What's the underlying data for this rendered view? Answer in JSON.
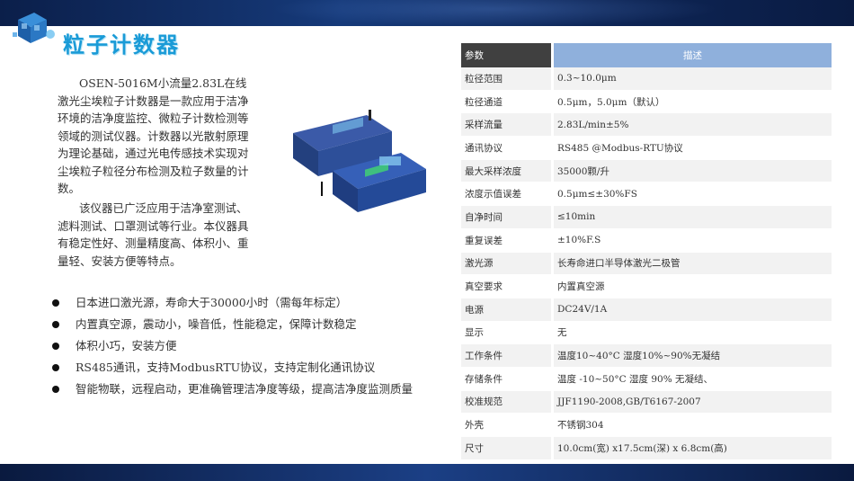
{
  "title": "粒子计数器",
  "intro": [
    "OSEN-5016M小流量2.83L在线激光尘埃粒子计数器是一款应用于洁净环境的洁净度监控、微粒子计数检测等领域的测试仪器。计数器以光散射原理为理论基础，通过光电传感技术实现对尘埃粒子粒径分布检测及粒子数量的计数。",
    "该仪器已广泛应用于洁净室测试、滤料测试、口罩测试等行业。本仪器具有稳定性好、测量精度高、体积小、重量轻、安装方便等特点。"
  ],
  "features": [
    "日本进口激光源，寿命大于30000小时（需每年标定）",
    "内置真空源，震动小，噪音低，性能稳定，保障计数稳定",
    "体积小巧，安装方便",
    "RS485通讯，支持ModbusRTU协议，支持定制化通讯协议",
    "智能物联，远程启动，更准确管理洁净度等级，提高洁净度监测质量"
  ],
  "table": {
    "headers": [
      "参数",
      "描述"
    ],
    "rows": [
      [
        "粒径范围",
        "0.3~10.0μm"
      ],
      [
        "粒径通道",
        "0.5μm，5.0μm（默认）"
      ],
      [
        "采样流量",
        "2.83L/min±5%"
      ],
      [
        "通讯协议",
        "RS485 @Modbus-RTU协议"
      ],
      [
        "最大采样浓度",
        "35000颗/升"
      ],
      [
        "浓度示值误差",
        "0.5μm≤±30%FS"
      ],
      [
        "自净时间",
        "≤10min"
      ],
      [
        "重复误差",
        "±10%F.S"
      ],
      [
        "激光源",
        "长寿命进口半导体激光二极管"
      ],
      [
        "真空要求",
        "内置真空源"
      ],
      [
        "电源",
        "DC24V/1A"
      ],
      [
        "显示",
        "无"
      ],
      [
        "工作条件",
        "温度10~40°C 湿度10%~90%无凝结"
      ],
      [
        "存储条件",
        "温度 -10~50°C 湿度 90% 无凝结、"
      ],
      [
        "校准规范",
        "JJF1190-2008,GB/T6167-2007"
      ],
      [
        "外壳",
        "不锈钢304"
      ],
      [
        "尺寸",
        "10.0cm(宽) x17.5cm(深) x 6.8cm(高)"
      ]
    ]
  },
  "colors": {
    "title": "#1a9bd7",
    "header_param_bg": "#404040",
    "header_desc_bg": "#8fb0dc",
    "band": "#0e2657"
  }
}
